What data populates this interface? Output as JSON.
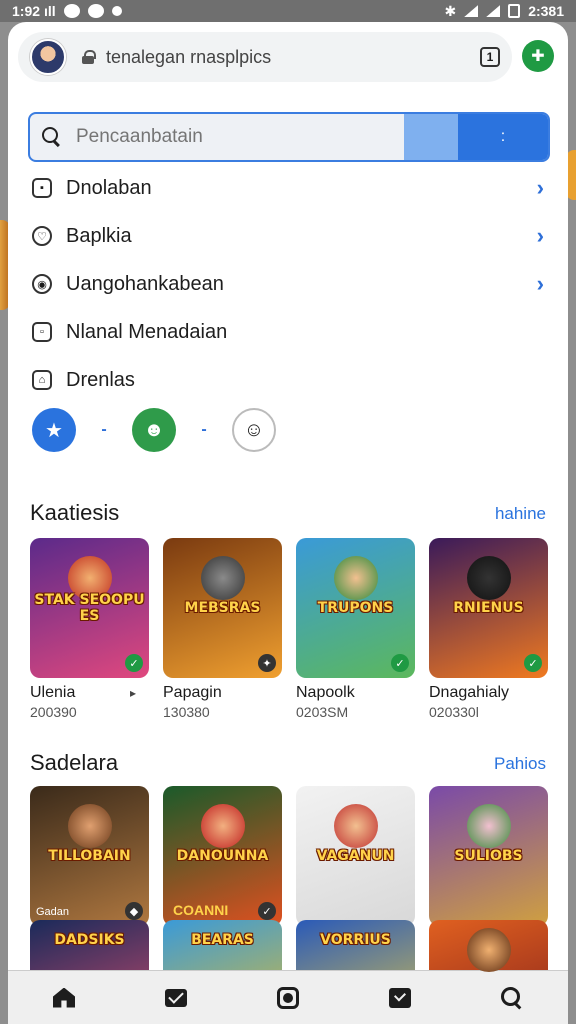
{
  "status_bar": {
    "time": "1:92",
    "clock": "2:381",
    "left_text": "ıll"
  },
  "browser": {
    "url": "tenalegan rnasplpics",
    "tabs_count": "1"
  },
  "search": {
    "placeholder": "Pencaanbatain",
    "button_label": ":"
  },
  "menu": [
    {
      "label": "Dnolaban",
      "icon": "square-icon",
      "chevron": "›"
    },
    {
      "label": "Baplkia",
      "icon": "heart-icon",
      "chevron": "›"
    },
    {
      "label": "Uangohankabean",
      "icon": "location-icon",
      "chevron": "›"
    },
    {
      "label": "Nlanal Menadaian",
      "icon": "window-icon",
      "chevron": ""
    },
    {
      "label": "Drenlas",
      "icon": "home-icon",
      "chevron": ""
    }
  ],
  "chips": {
    "separator": "-"
  },
  "section1": {
    "title": "Kaatiesis",
    "link": "hahine",
    "games": [
      {
        "title": "STAK SEOOPUES",
        "name": "Ulenia",
        "meta": "200390",
        "colors": [
          "#5b2a8a",
          "#e0487e"
        ],
        "badge": "✓"
      },
      {
        "title": "MEBSRAS",
        "name": "Papagin",
        "meta": "130380",
        "colors": [
          "#7a3a10",
          "#f0a030"
        ],
        "badge": "✦"
      },
      {
        "title": "TRUPONS",
        "name": "Napoolk",
        "meta": "0203SM",
        "colors": [
          "#3a9ad8",
          "#5cb85c"
        ],
        "badge": "✓"
      },
      {
        "title": "RNIENUS",
        "name": "Dnagahialy",
        "meta": "020330l",
        "colors": [
          "#3a1a5a",
          "#f07a20"
        ],
        "badge": "✓"
      }
    ],
    "more": "▸"
  },
  "section2": {
    "title": "Sadelara",
    "link": "Pahios",
    "games": [
      {
        "title": "TILLOBAIN",
        "label": "Gadan",
        "colors": [
          "#3a2a1a",
          "#b07840"
        ],
        "badge": "◆"
      },
      {
        "title": "DANOUNNA",
        "label": "COANNI",
        "colors": [
          "#1a5a2a",
          "#e05020"
        ],
        "badge": "✓"
      },
      {
        "title": "VAGANUN",
        "label": "",
        "colors": [
          "#f2f2f2",
          "#d8d8d8"
        ],
        "badge": ""
      },
      {
        "title": "SULIOBS",
        "label": "",
        "colors": [
          "#7a4aa8",
          "#d0a040"
        ],
        "badge": ""
      }
    ]
  },
  "section3": {
    "games": [
      {
        "title": "DADSIKS",
        "colors": [
          "#1a2a5a",
          "#e05070"
        ]
      },
      {
        "title": "BEARAS",
        "colors": [
          "#3a9ad8",
          "#f0c020"
        ]
      },
      {
        "title": "VORRIUS",
        "colors": [
          "#2a5ab8",
          "#f0d040"
        ]
      },
      {
        "title": "",
        "colors": [
          "#e06020",
          "#7a1a1a"
        ]
      }
    ]
  },
  "bottom_nav": [
    "home-icon",
    "inbox-icon",
    "camera-icon",
    "download-icon",
    "search-icon"
  ]
}
